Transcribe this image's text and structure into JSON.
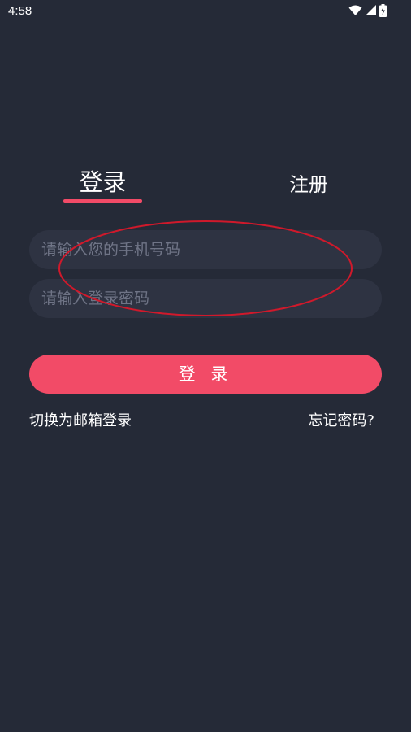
{
  "status_bar": {
    "time": "4:58",
    "icons": [
      "wifi-icon",
      "signal-icon",
      "battery-charging-icon"
    ]
  },
  "tabs": [
    {
      "label": "登录",
      "active": true
    },
    {
      "label": "注册",
      "active": false
    }
  ],
  "form": {
    "phone_placeholder": "请输入您的手机号码",
    "phone_value": "",
    "password_placeholder": "请输入登录密码",
    "password_value": "",
    "submit_label": "登 录"
  },
  "links": {
    "switch_email": "切换为邮箱登录",
    "forgot_password": "忘记密码?"
  },
  "colors": {
    "background": "#252a37",
    "field_background": "#2e3342",
    "accent": "#f24b67",
    "annotation": "#d0192b"
  }
}
